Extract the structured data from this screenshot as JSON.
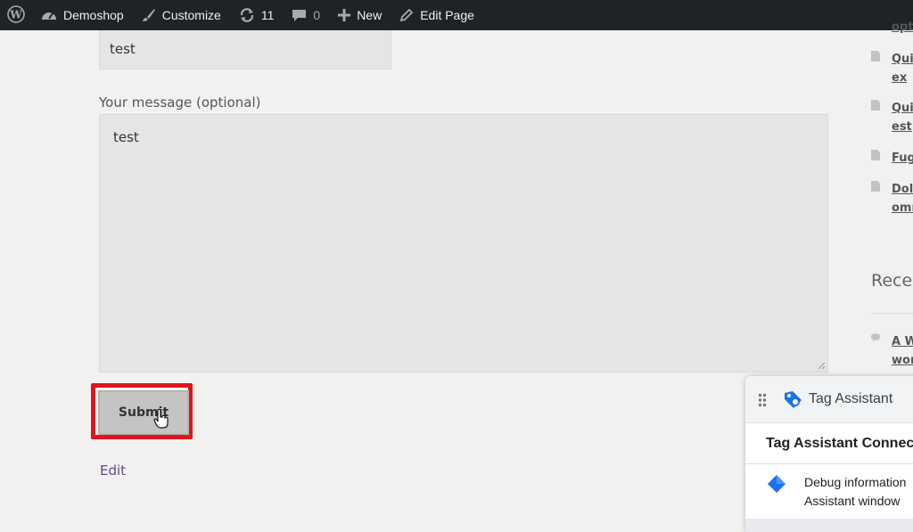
{
  "admin_bar": {
    "site_name": "Demoshop",
    "customize": "Customize",
    "updates_count": "11",
    "comments_count": "0",
    "new": "New",
    "edit_page": "Edit Page"
  },
  "form": {
    "name_value": "test",
    "message_label": "Your message (optional)",
    "message_value": "test",
    "submit_label": "Submit",
    "edit_link": "Edit"
  },
  "sidebar": {
    "pages": [
      {
        "line1": "Qui",
        "line2": "ex"
      },
      {
        "line1": "Quia",
        "line2": "est"
      },
      {
        "line1": "Fugi",
        "line2": ""
      },
      {
        "line1": "Dolo",
        "line2": "omn"
      }
    ],
    "top_partial": "opti",
    "recent_heading": "Recen",
    "recent_comment": {
      "line1": "A Wo",
      "line2": "wor"
    }
  },
  "tag_assistant": {
    "title": "Tag Assistant",
    "connected_text": "Tag Assistant Connec",
    "debug_line1": "Debug information",
    "debug_line2": "Assistant window"
  },
  "colors": {
    "admin_bar": "#1d2327",
    "highlight": "#e0141b",
    "link": "#5a4a8e",
    "tag_blue": "#1a73e8"
  }
}
